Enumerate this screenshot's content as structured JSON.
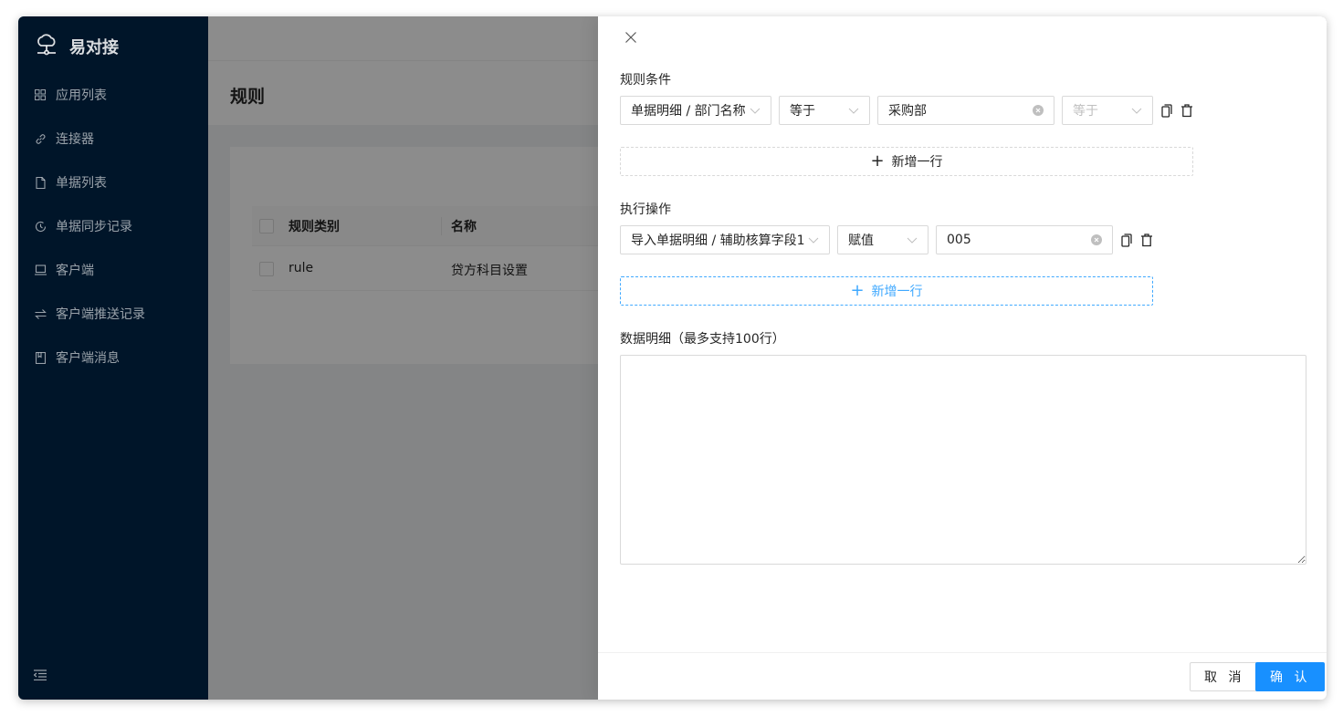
{
  "app": {
    "title": "易对接"
  },
  "sidebar": {
    "items": [
      {
        "label": "应用列表",
        "icon": "grid-icon"
      },
      {
        "label": "连接器",
        "icon": "link-icon"
      },
      {
        "label": "单据列表",
        "icon": "file-icon"
      },
      {
        "label": "单据同步记录",
        "icon": "history-icon"
      },
      {
        "label": "客户端",
        "icon": "laptop-icon"
      },
      {
        "label": "客户端推送记录",
        "icon": "swap-icon"
      },
      {
        "label": "客户端消息",
        "icon": "book-icon"
      }
    ],
    "collapse_icon": "menu-fold-icon"
  },
  "page": {
    "title": "规则"
  },
  "table": {
    "columns": [
      "规则类别",
      "名称"
    ],
    "rows": [
      {
        "type": "rule",
        "name": "贷方科目设置"
      }
    ]
  },
  "drawer": {
    "conditions": {
      "label": "规则条件",
      "rows": [
        {
          "field": "单据明细 / 部门名称",
          "operator": "等于",
          "value": "采购部",
          "logic": "等于"
        }
      ],
      "add_label": "新增一行"
    },
    "actions": {
      "label": "执行操作",
      "rows": [
        {
          "field": "导入单据明细 / 辅助核算字段1",
          "operator": "赋值",
          "value": "005"
        }
      ],
      "add_label": "新增一行"
    },
    "data_detail": {
      "label": "数据明细（最多支持100行）",
      "value": ""
    },
    "footer": {
      "cancel_label": "取 消",
      "ok_label": "确 认"
    }
  },
  "colors": {
    "sidebar_bg": "#001529",
    "primary": "#1890ff",
    "dashed_active": "#40a9ff"
  }
}
